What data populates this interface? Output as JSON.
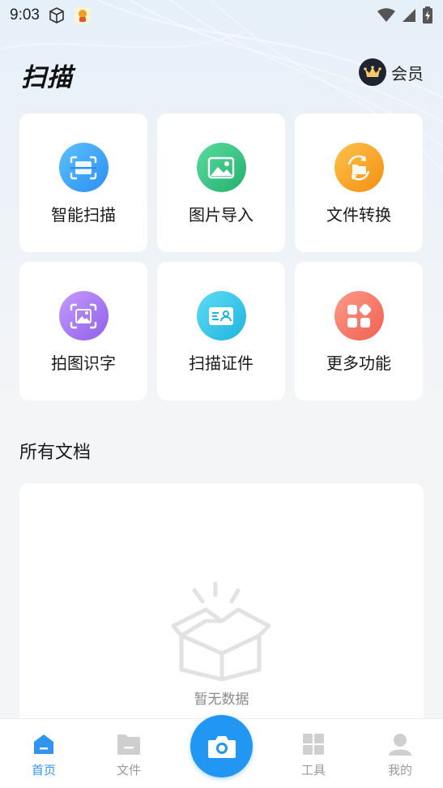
{
  "status_bar": {
    "time": "9:03"
  },
  "header": {
    "title": "扫描",
    "vip_label": "会员"
  },
  "features": [
    {
      "label": "智能扫描",
      "icon": "scan-icon",
      "color": "#3aa3f3"
    },
    {
      "label": "图片导入",
      "icon": "image-import-icon",
      "color": "#31c27f"
    },
    {
      "label": "文件转换",
      "icon": "file-convert-icon",
      "color": "#f7a623"
    },
    {
      "label": "拍图识字",
      "icon": "photo-ocr-icon",
      "color": "#a77bf0"
    },
    {
      "label": "扫描证件",
      "icon": "id-card-icon",
      "color": "#33c3e8"
    },
    {
      "label": "更多功能",
      "icon": "more-apps-icon",
      "color": "#f5756a"
    }
  ],
  "documents": {
    "section_title": "所有文档",
    "empty_text": "暂无数据"
  },
  "bottom_nav": {
    "items": [
      {
        "label": "首页",
        "icon": "home-icon",
        "active": true
      },
      {
        "label": "文件",
        "icon": "folder-icon",
        "active": false
      },
      {
        "label": "工具",
        "icon": "tools-grid-icon",
        "active": false
      },
      {
        "label": "我的",
        "icon": "profile-icon",
        "active": false
      }
    ],
    "camera_icon": "camera-icon"
  },
  "colors": {
    "accent": "#2196f3",
    "active_nav": "#2f95f0",
    "inactive_nav": "#9a9a9a"
  }
}
